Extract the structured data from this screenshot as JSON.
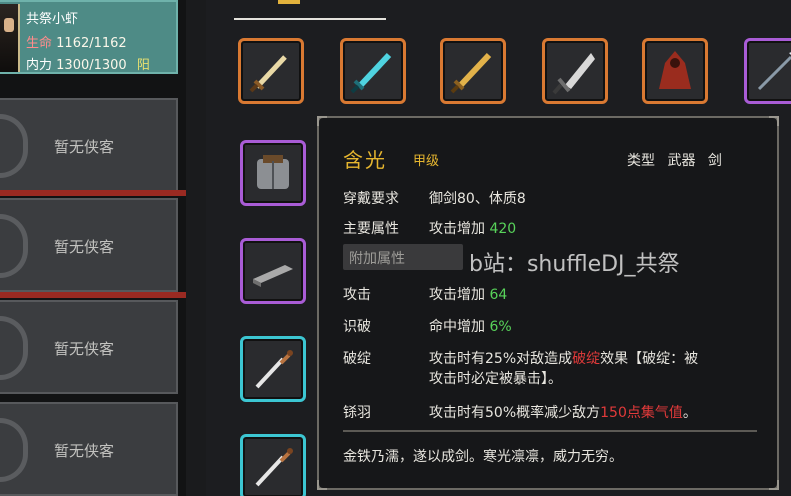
{
  "hero": {
    "name": "共祭小虾",
    "hp_label": "生命",
    "hp_value": "1162/1162",
    "mp_label": "内力",
    "mp_value": "1300/1300",
    "alignment": "阳"
  },
  "party_slots": [
    {
      "label": "暂无侠客"
    },
    {
      "label": "暂无侠客"
    },
    {
      "label": "暂无侠客"
    },
    {
      "label": "暂无侠客"
    }
  ],
  "inventory": {
    "items": [
      {
        "icon": "short-sword-icon",
        "rarity": "orange"
      },
      {
        "icon": "cyan-sword-icon",
        "rarity": "orange"
      },
      {
        "icon": "gold-sword-icon",
        "rarity": "orange"
      },
      {
        "icon": "broadsword-icon",
        "rarity": "orange"
      },
      {
        "icon": "cloak-icon",
        "rarity": "orange"
      },
      {
        "icon": "spear-icon",
        "rarity": "purple"
      },
      {
        "icon": "armor-vest-icon",
        "rarity": "purple"
      },
      {
        "icon": "metal-bar-icon",
        "rarity": "purple"
      },
      {
        "icon": "dagger-icon",
        "rarity": "cyan"
      },
      {
        "icon": "dagger-icon",
        "rarity": "cyan"
      }
    ]
  },
  "tooltip": {
    "name": "含光",
    "grade": "甲级",
    "type_label": "类型",
    "type_value": "武器 剑",
    "requirement_label": "穿戴要求",
    "requirement_value": "御剑80、体质8",
    "main_attr_label": "主要属性",
    "main_attr_text": "攻击增加",
    "main_attr_value": "420",
    "extra_attr_label": "附加属性",
    "attack_label": "攻击",
    "attack_text": "攻击增加",
    "attack_value": "64",
    "insight_label": "识破",
    "insight_text": "命中增加",
    "insight_value": "6%",
    "flaw_label": "破绽",
    "flaw_line1_a": "攻击时有25%对敌造成",
    "flaw_line1_red": "破绽",
    "flaw_line1_b": "效果【破绽：被",
    "flaw_line2": "攻击时必定被暴击】。",
    "feather_label": "铩羽",
    "feather_text_a": "攻击时有50%概率减少敌方",
    "feather_text_red": "150点集气值",
    "feather_text_b": "。",
    "description": "金铁乃濡，遂以成剑。寒光凛凛，威力无穷。"
  },
  "watermark": "b站：shuffleDJ_共祭",
  "colors": {
    "gold": "#e6b62f",
    "green": "#58d35a",
    "red": "#e23a3a",
    "hero_teal": "#4e8b86"
  }
}
